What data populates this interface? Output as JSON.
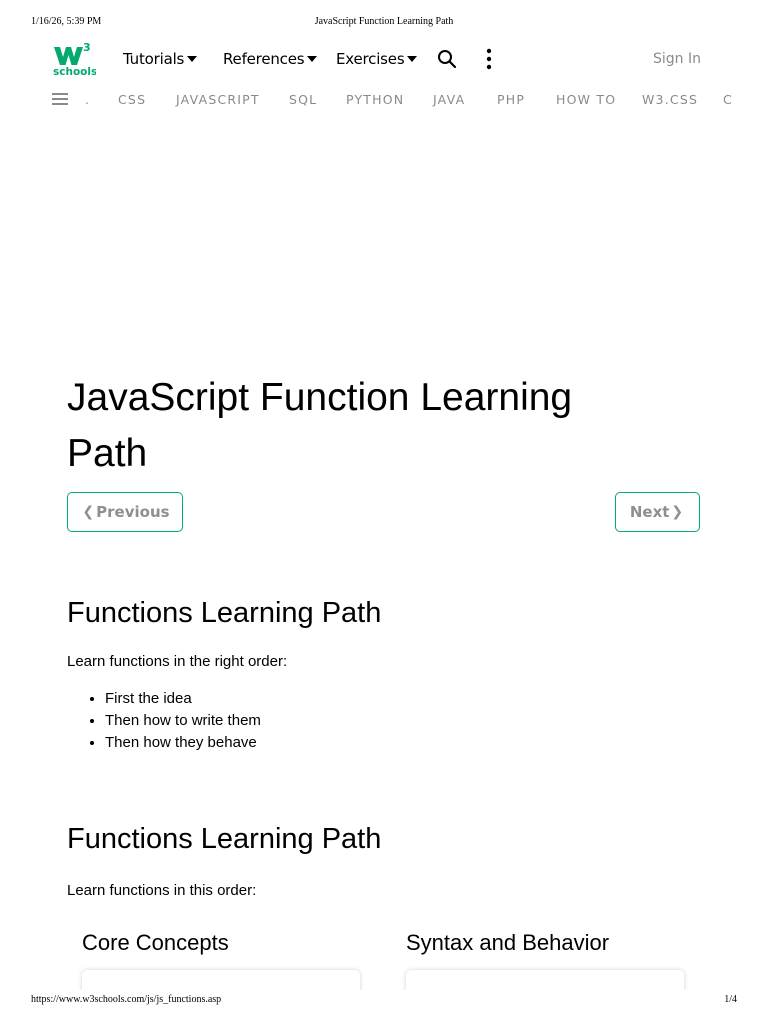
{
  "print": {
    "datetime": "1/16/26, 5:39 PM",
    "doc_title": "JavaScript Function Learning Path",
    "url": "https://www.w3schools.com/js/js_functions.asp",
    "page_num": "1/4"
  },
  "topnav": {
    "logo_sup": "3",
    "logo_text": "schools",
    "menus": [
      "Tutorials",
      "References",
      "Exercises"
    ],
    "sign_in": "Sign In"
  },
  "subnav": {
    "items": [
      ".",
      "CSS",
      "JAVASCRIPT",
      "SQL",
      "PYTHON",
      "JAVA",
      "PHP",
      "HOW TO",
      "W3.CSS",
      "C"
    ]
  },
  "main": {
    "title_line1": "JavaScript Function Learning",
    "title_line2": "Path",
    "prev_label": "Previous",
    "next_label": "Next",
    "section1": {
      "heading": "Functions Learning Path",
      "intro": "Learn functions in the right order:",
      "items": [
        "First the idea",
        "Then how to write them",
        "Then how they behave"
      ]
    },
    "section2": {
      "heading": "Functions Learning Path",
      "intro": "Learn functions in this order:",
      "cards": [
        "Core Concepts",
        "Syntax and Behavior"
      ]
    }
  },
  "colors": {
    "accent": "#04aa6d",
    "muted": "#8a8a8a"
  }
}
